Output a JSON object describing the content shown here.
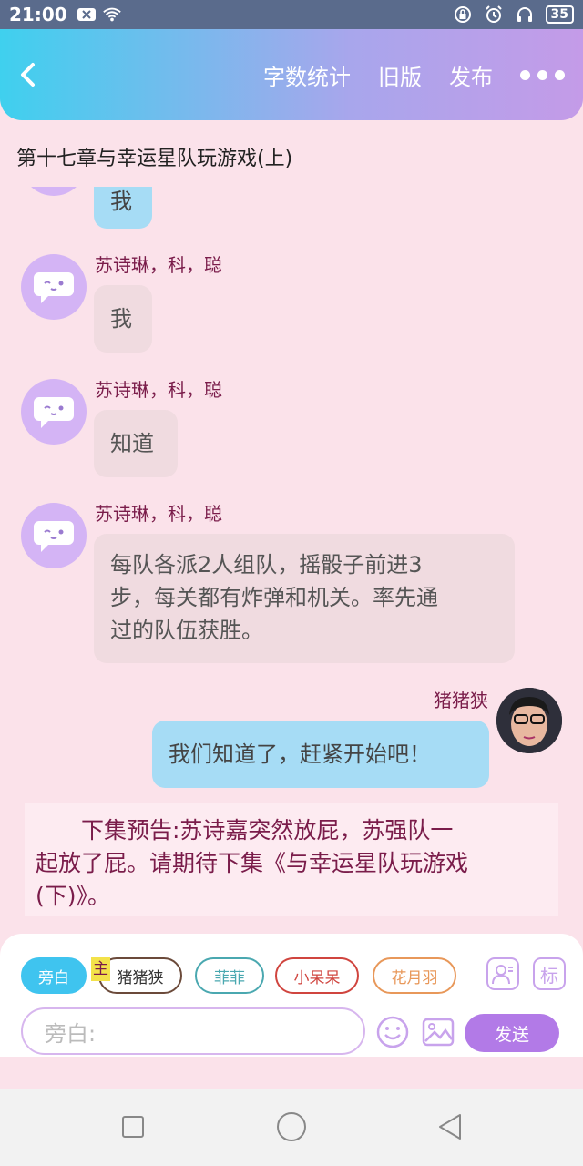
{
  "status": {
    "time": "21:00",
    "battery": "35"
  },
  "header": {
    "stats_label": "字数统计",
    "old_version_label": "旧版",
    "publish_label": "发布"
  },
  "chapter_title": "第十七章与幸运星队玩游戏(上)",
  "messages": [
    {
      "side": "left",
      "sender": "",
      "text": "我"
    },
    {
      "side": "left",
      "sender": "苏诗琳，科，聪",
      "text": "我"
    },
    {
      "side": "left",
      "sender": "苏诗琳，科，聪",
      "text": "知道"
    },
    {
      "side": "left",
      "sender": "苏诗琳，科，聪",
      "lines": [
        "每队各派2人组队，摇骰子前进3",
        "步，每关都有炸弹和机关。率先通",
        "过的队伍获胜。"
      ]
    },
    {
      "side": "right",
      "sender": "猪猪狭",
      "text": "我们知道了，赶紧开始吧！"
    }
  ],
  "preview": {
    "lines": [
      "下集预告:苏诗嘉突然放屁，苏强队一",
      "起放了屁。请期待下集《与幸运星队玩游戏",
      "(下)》。"
    ]
  },
  "roles": [
    {
      "label": "旁白",
      "active": true,
      "color": "#3fc4ef"
    },
    {
      "label": "猪猪狭",
      "active": false,
      "color": "#6b4a3a"
    },
    {
      "label": "菲菲",
      "active": false,
      "color": "#4aa8b0"
    },
    {
      "label": "小呆呆",
      "active": false,
      "color": "#d0453f"
    },
    {
      "label": "花月羽",
      "active": false,
      "color": "#e8985a"
    }
  ],
  "main_badge": "主",
  "tools": {
    "tag_label": "标"
  },
  "input": {
    "placeholder": "旁白:"
  },
  "send_label": "发送",
  "icons": [
    "wifi-icon",
    "lock-icon",
    "alarm-icon",
    "headphone-icon",
    "back-arrow-icon",
    "more-icon",
    "role-icon",
    "emoji-icon",
    "image-icon",
    "nav-square-icon",
    "nav-circle-icon",
    "nav-back-icon"
  ]
}
